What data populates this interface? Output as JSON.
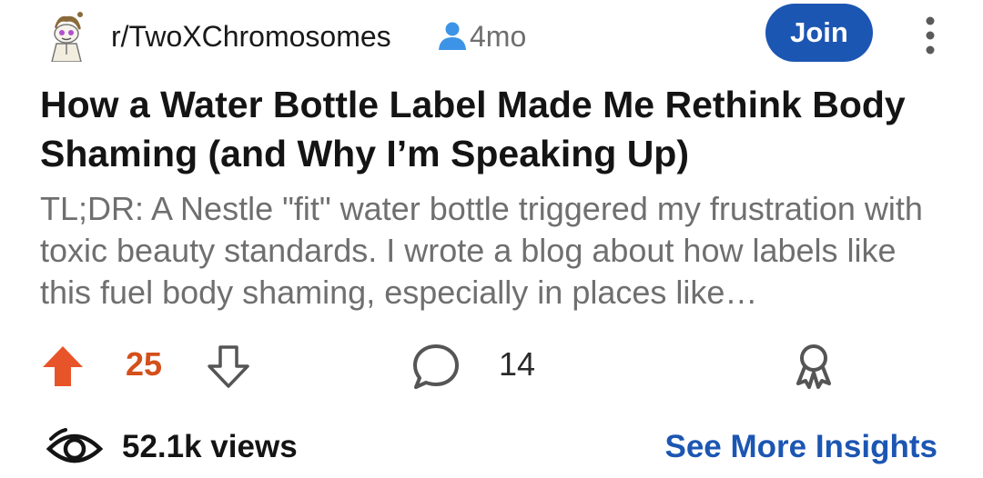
{
  "post": {
    "subreddit": "r/TwoXChromosomes",
    "age": "4mo",
    "join_label": "Join",
    "title": "How a Water Bottle Label Made Me Rethink Body Shaming (and Why I’m Speaking Up)",
    "snippet": "TL;DR: A Nestle \"fit\" water bottle triggered my frustration with toxic beauty standards. I wrote a blog about how labels like this fuel body shaming, especially in places like…"
  },
  "actions": {
    "vote_count": "25",
    "comment_count": "14"
  },
  "footer": {
    "views": "52.1k views",
    "insights_label": "See More Insights"
  },
  "colors": {
    "accent_blue": "#1c56b3",
    "upvote_orange": "#e8542a"
  },
  "icons": {
    "avatar": "subreddit-avatar-icon",
    "author": "user-icon",
    "more": "more-vertical-icon",
    "upvote": "upvote-arrow-icon",
    "downvote": "downvote-arrow-icon",
    "comment": "comment-bubble-icon",
    "award": "award-icon",
    "views": "eye-icon"
  }
}
